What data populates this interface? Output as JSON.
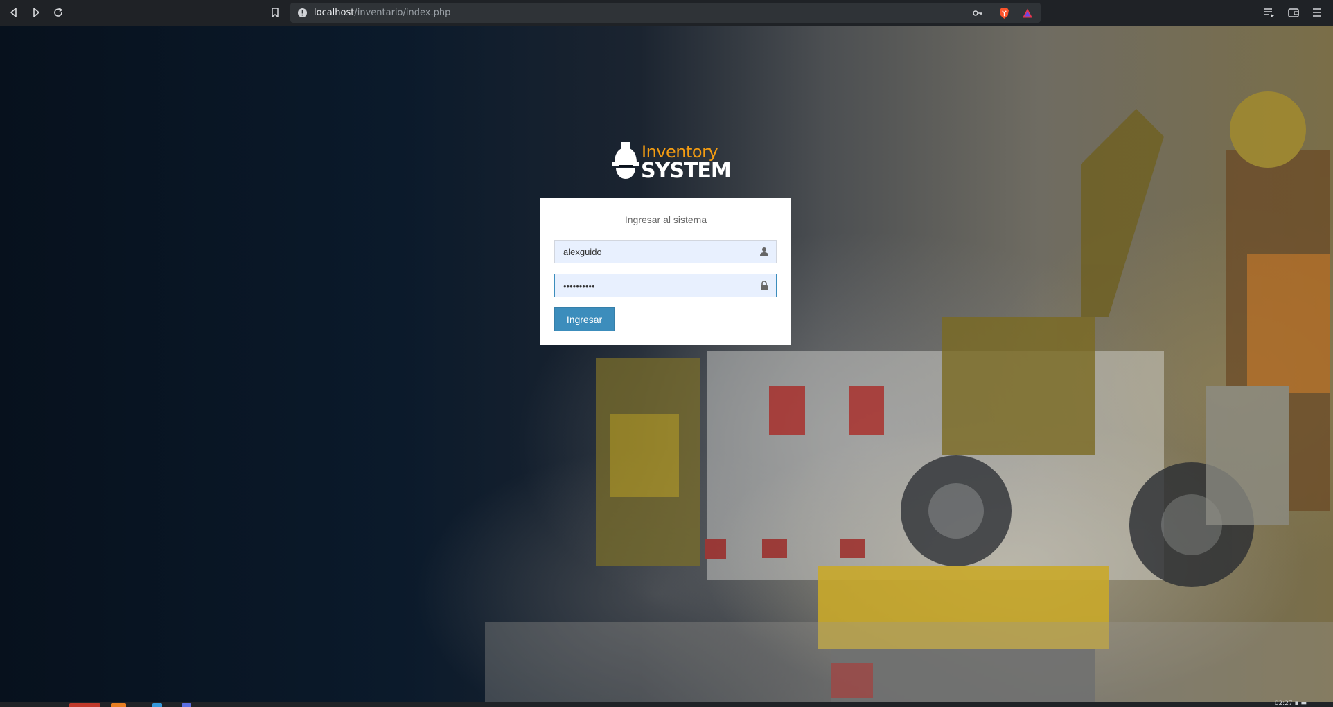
{
  "browser": {
    "url_host": "localhost",
    "url_path": "/inventario/index.php",
    "icons": [
      "back-icon",
      "forward-icon",
      "reload-icon",
      "bookmark-icon",
      "site-info-icon",
      "key-icon",
      "brave-shield-icon",
      "brave-rewards-icon",
      "playlist-icon",
      "wallet-icon",
      "menu-icon"
    ]
  },
  "logo": {
    "word_top": "Inventory",
    "word_bottom": "SYSTEM",
    "accent_color": "#f39c12"
  },
  "login": {
    "title": "Ingresar al sistema",
    "username_value": "alexguido",
    "password_value": "••••••••••",
    "submit_label": "Ingresar",
    "button_color": "#3c8dbc"
  },
  "taskbar": {
    "clock": "02:27 ▪ ▬"
  }
}
